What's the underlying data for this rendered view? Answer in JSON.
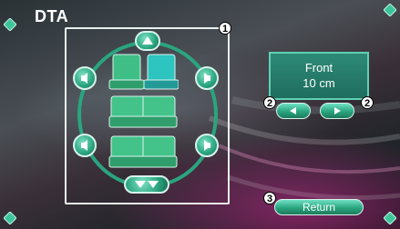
{
  "screen": {
    "title": "DTA"
  },
  "info": {
    "position": "Front",
    "value": "10 cm"
  },
  "buttons": {
    "return_label": "Return"
  },
  "callouts": {
    "n1": "1",
    "n2a": "2",
    "n2b": "2",
    "n3": "3"
  },
  "seat_grid": {
    "rows": 3,
    "selected": "front-right"
  },
  "colors": {
    "accent": "#2aa57f",
    "selected_seat": "#2ec4c0",
    "seat": "#43c38a"
  },
  "icons": [
    "corner-arrow-icon",
    "up-arrow-icon",
    "down-arrow-icon",
    "speaker-left-icon",
    "speaker-right-icon",
    "left-arrow-icon",
    "right-arrow-icon"
  ]
}
